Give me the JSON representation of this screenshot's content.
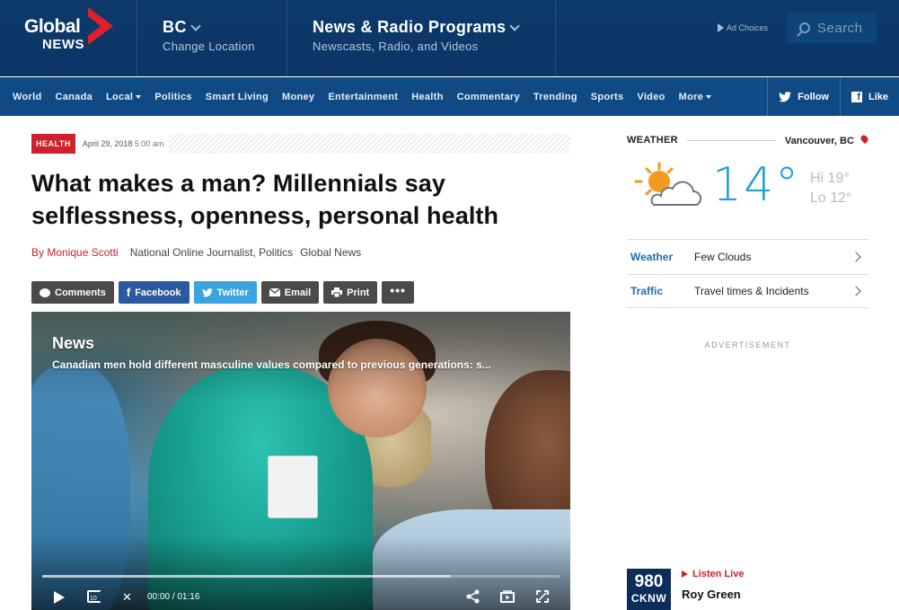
{
  "header": {
    "logo_top": "Global",
    "logo_bottom": "NEWS",
    "region": {
      "title": "BC",
      "subtitle": "Change Location"
    },
    "programs": {
      "title": "News & Radio Programs",
      "subtitle": "Newscasts, Radio, and Videos"
    },
    "ad_choices": "Ad Choices",
    "search_placeholder": "Search"
  },
  "nav": {
    "items": [
      "World",
      "Canada",
      "Local",
      "Politics",
      "Smart Living",
      "Money",
      "Entertainment",
      "Health",
      "Commentary",
      "Trending",
      "Sports",
      "Video",
      "More"
    ],
    "follow": "Follow",
    "like": "Like"
  },
  "article": {
    "category": "HEALTH",
    "date": "April 29, 2018",
    "time": "5:00 am",
    "headline_line1": "What makes a man? Millennials say",
    "headline_line2": "selflessness, openness, personal health",
    "byline": "By Monique Scotti",
    "role": "National Online Journalist, Politics",
    "outlet": "Global News",
    "share": {
      "comments": "Comments",
      "facebook": "Facebook",
      "twitter": "Twitter",
      "email": "Email",
      "print": "Print",
      "more": "•••"
    }
  },
  "video": {
    "title": "News",
    "subtitle": "Canadian men hold different masculine values compared to previous generations: s...",
    "replay_seconds": "10",
    "current_time": "00:00",
    "separator": "/",
    "duration": "01:16",
    "buffered_fraction": 0.79
  },
  "weather": {
    "label": "WEATHER",
    "location": "Vancouver, BC",
    "temp": "14°",
    "hi": "Hi 19°",
    "lo": "Lo 12°",
    "rows": [
      {
        "key": "Weather",
        "value": "Few Clouds"
      },
      {
        "key": "Traffic",
        "value": "Travel times & Incidents"
      }
    ]
  },
  "advertisement_label": "ADVERTISEMENT",
  "radio": {
    "frequency": "980",
    "callsign": "CKNW",
    "listen_live": "Listen Live",
    "host": "Roy Green"
  },
  "colors": {
    "header_bg": "#0c3a6b",
    "nav_bg": "#0f4a85",
    "accent_red": "#d0202d",
    "temp_blue": "#1e9fd7",
    "link_blue": "#1d6fb0"
  }
}
